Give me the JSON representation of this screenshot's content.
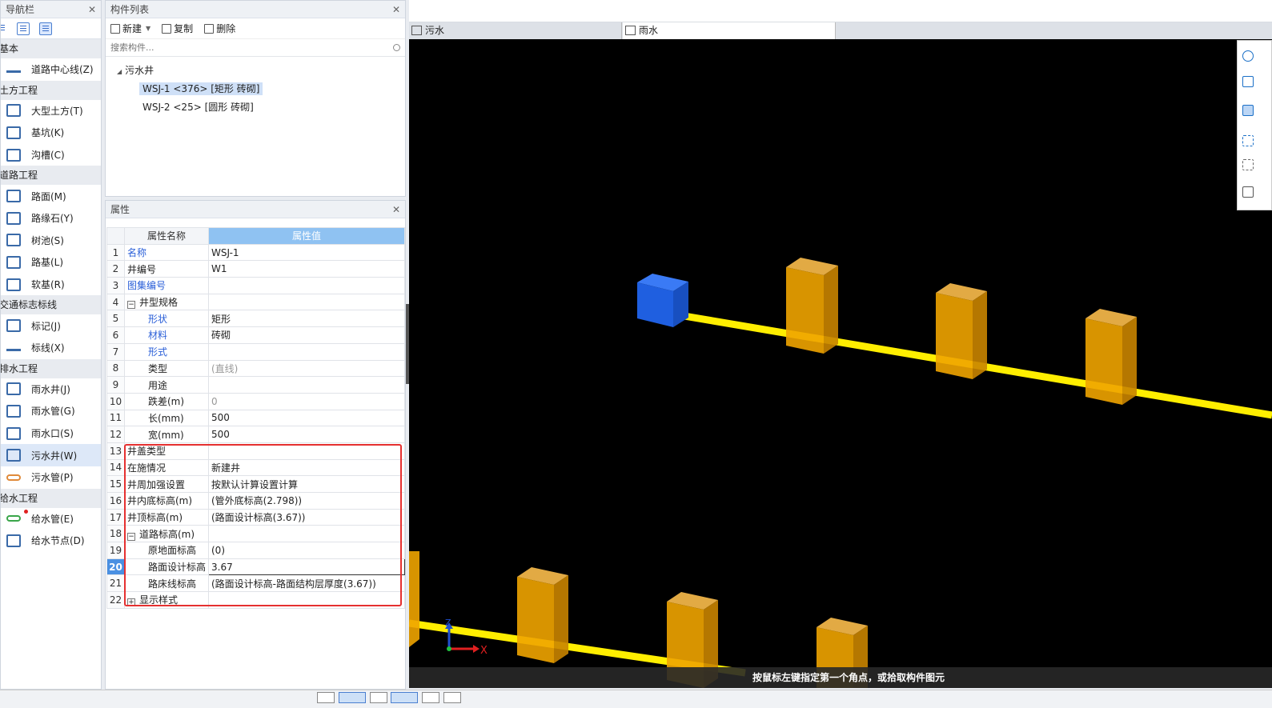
{
  "nav": {
    "title": "导航栏",
    "categories": [
      {
        "label": "基本",
        "items": [
          {
            "label": "道路中心线(Z)",
            "icon": "road-centerline-icon"
          }
        ]
      },
      {
        "label": "土方工程",
        "items": [
          {
            "label": "大型土方(T)",
            "icon": "earthwork-icon"
          },
          {
            "label": "基坑(K)",
            "icon": "foundation-pit-icon"
          },
          {
            "label": "沟槽(C)",
            "icon": "trench-icon"
          }
        ]
      },
      {
        "label": "道路工程",
        "items": [
          {
            "label": "路面(M)",
            "icon": "pavement-icon"
          },
          {
            "label": "路缘石(Y)",
            "icon": "curb-icon"
          },
          {
            "label": "树池(S)",
            "icon": "tree-pit-icon"
          },
          {
            "label": "路基(L)",
            "icon": "subgrade-icon"
          },
          {
            "label": "软基(R)",
            "icon": "soft-foundation-icon"
          }
        ]
      },
      {
        "label": "交通标志标线",
        "items": [
          {
            "label": "标记(J)",
            "icon": "marking-icon"
          },
          {
            "label": "标线(X)",
            "icon": "line-marking-icon"
          }
        ]
      },
      {
        "label": "排水工程",
        "items": [
          {
            "label": "雨水井(J)",
            "icon": "rain-well-icon"
          },
          {
            "label": "雨水管(G)",
            "icon": "rain-pipe-icon"
          },
          {
            "label": "雨水口(S)",
            "icon": "rain-inlet-icon"
          },
          {
            "label": "污水井(W)",
            "icon": "sewage-well-icon",
            "selected": true
          },
          {
            "label": "污水管(P)",
            "icon": "sewage-pipe-icon"
          }
        ]
      },
      {
        "label": "给水工程",
        "items": [
          {
            "label": "给水管(E)",
            "icon": "water-pipe-icon"
          },
          {
            "label": "给水节点(D)",
            "icon": "water-node-icon"
          }
        ]
      }
    ]
  },
  "components": {
    "title": "构件列表",
    "new_label": "新建",
    "copy_label": "复制",
    "delete_label": "删除",
    "search_placeholder": "搜索构件...",
    "root": "污水井",
    "items": [
      {
        "label": "WSJ-1 <376> [矩形 砖砌]",
        "selected": true
      },
      {
        "label": "WSJ-2 <25> [圆形 砖砌]",
        "selected": false
      }
    ]
  },
  "properties": {
    "title": "属性",
    "col_name": "属性名称",
    "col_value": "属性值",
    "rows": [
      {
        "n": "1",
        "name": "名称",
        "value": "WSJ-1",
        "blue": true
      },
      {
        "n": "2",
        "name": "井编号",
        "value": "W1"
      },
      {
        "n": "3",
        "name": "图集编号",
        "value": "",
        "blue": true
      },
      {
        "n": "4",
        "name": "井型规格",
        "value": "",
        "group": "−"
      },
      {
        "n": "5",
        "name": "形状",
        "value": "矩形",
        "blue": true,
        "indent": true
      },
      {
        "n": "6",
        "name": "材料",
        "value": "砖砌",
        "blue": true,
        "indent": true
      },
      {
        "n": "7",
        "name": "形式",
        "value": "",
        "blue": true,
        "indent": true
      },
      {
        "n": "8",
        "name": "类型",
        "value": "(直线)",
        "indent": true,
        "gray": true
      },
      {
        "n": "9",
        "name": "用途",
        "value": "",
        "indent": true
      },
      {
        "n": "10",
        "name": "跌差(m)",
        "value": "0",
        "indent": true,
        "gray": true
      },
      {
        "n": "11",
        "name": "长(mm)",
        "value": "500",
        "indent": true
      },
      {
        "n": "12",
        "name": "宽(mm)",
        "value": "500",
        "indent": true
      },
      {
        "n": "13",
        "name": "井盖类型",
        "value": ""
      },
      {
        "n": "14",
        "name": "在施情况",
        "value": "新建井"
      },
      {
        "n": "15",
        "name": "井周加强设置",
        "value": "按默认计算设置计算"
      },
      {
        "n": "16",
        "name": "井内底标高(m)",
        "value": "(管外底标高(2.798))"
      },
      {
        "n": "17",
        "name": "井顶标高(m)",
        "value": "(路面设计标高(3.67))"
      },
      {
        "n": "18",
        "name": "道路标高(m)",
        "value": "",
        "group": "−"
      },
      {
        "n": "19",
        "name": "原地面标高",
        "value": "(0)",
        "indent": true
      },
      {
        "n": "20",
        "name": "路面设计标高",
        "value": "3.67",
        "indent": true,
        "current": true
      },
      {
        "n": "21",
        "name": "路床线标高",
        "value": "(路面设计标高-路面结构层厚度(3.67))",
        "indent": true
      },
      {
        "n": "22",
        "name": "显示样式",
        "value": "",
        "group": "+"
      }
    ]
  },
  "tabs": [
    {
      "label": "污水"
    },
    {
      "label": "雨水"
    }
  ],
  "viewport": {
    "hint": "按鼠标左键指定第一个角点，或拾取构件图元",
    "axis_x": "X",
    "axis_z": "Z"
  },
  "colors": {
    "pipe": "#ffee00",
    "well": "#f0a400",
    "selected_well": "#1f5fe0"
  }
}
